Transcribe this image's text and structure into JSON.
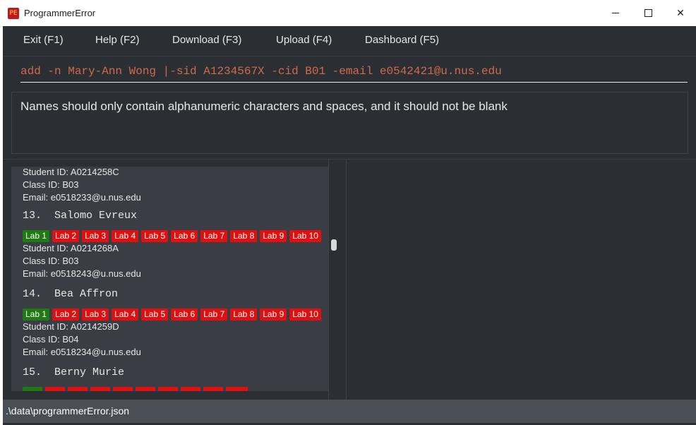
{
  "window": {
    "title": "ProgrammerError",
    "icon_name": "app-logo-icon",
    "controls": {
      "minimize": "minimize-icon",
      "maximize": "maximize-icon",
      "close": "close-icon"
    }
  },
  "menu": {
    "items": [
      "Exit (F1)",
      "Help (F2)",
      "Download (F3)",
      "Upload (F4)",
      "Dashboard (F5)"
    ]
  },
  "command": {
    "value": "add -n Mary-Ann Wong |-sid A1234567X -cid B01 -email e0542421@u.nus.edu"
  },
  "result": {
    "message": "Names should only contain alphanumeric characters and spaces, and it should not be blank"
  },
  "students": {
    "partial_top": {
      "student_id": "Student ID: A0214258C",
      "class_id": "Class ID: B03",
      "email": "Email: e0518233@u.nus.edu"
    },
    "entries": [
      {
        "name": "13.  Salomo Evreux",
        "labs": [
          "Lab 1",
          "Lab 2",
          "Lab 3",
          "Lab 4",
          "Lab 5",
          "Lab 6",
          "Lab 7",
          "Lab 8",
          "Lab 9",
          "Lab 10"
        ],
        "student_id": "Student ID: A0214268A",
        "class_id": "Class ID: B03",
        "email": "Email: e0518243@u.nus.edu"
      },
      {
        "name": "14.  Bea Affron",
        "labs": [
          "Lab 1",
          "Lab 2",
          "Lab 3",
          "Lab 4",
          "Lab 5",
          "Lab 6",
          "Lab 7",
          "Lab 8",
          "Lab 9",
          "Lab 10"
        ],
        "student_id": "Student ID: A0214259D",
        "class_id": "Class ID: B04",
        "email": "Email: e0518234@u.nus.edu"
      },
      {
        "name": "15.  Berny Murie"
      }
    ],
    "lab_colors": {
      "done": "#1f7a12",
      "not_done": "#e01010"
    }
  },
  "status_bar": {
    "path": ".\\data\\programmerError.json"
  }
}
